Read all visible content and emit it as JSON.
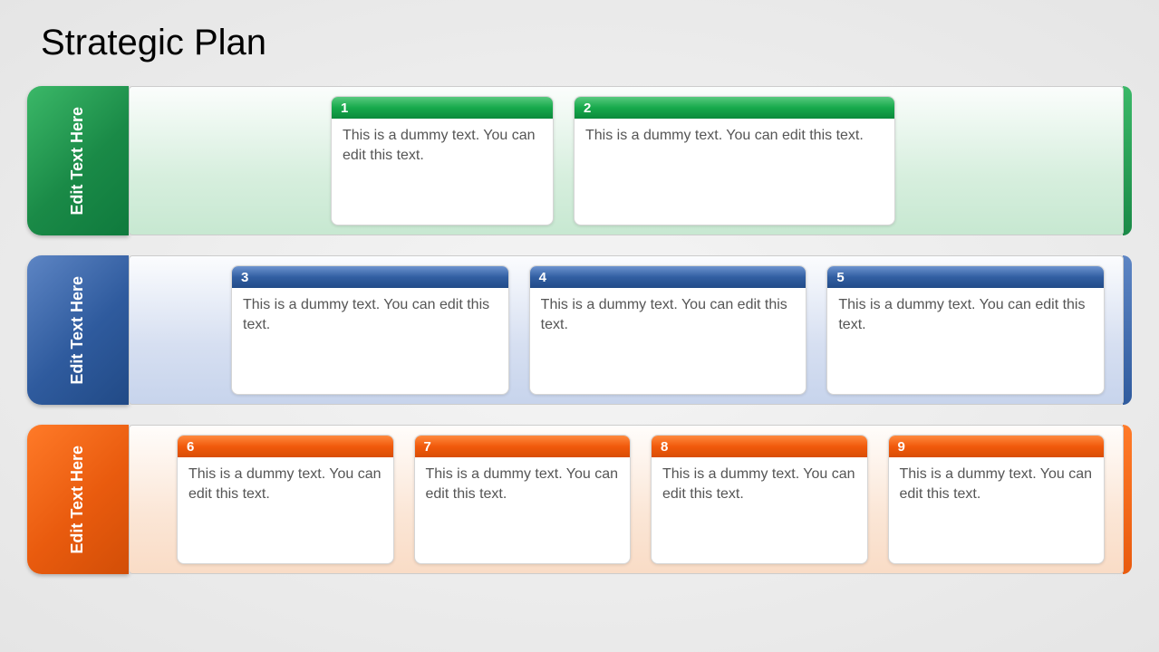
{
  "title": "Strategic Plan",
  "rows": [
    {
      "tab": "Edit Text Here",
      "cards": [
        {
          "num": "1",
          "text": "This is a dummy text. You can edit this text."
        },
        {
          "num": "2",
          "text": "This is a dummy text. You can edit this text."
        }
      ]
    },
    {
      "tab": "Edit Text Here",
      "cards": [
        {
          "num": "3",
          "text": "This is a dummy text. You can edit this text."
        },
        {
          "num": "4",
          "text": "This is a dummy text. You can edit this text."
        },
        {
          "num": "5",
          "text": "This is a dummy text. You can edit this text."
        }
      ]
    },
    {
      "tab": "Edit Text Here",
      "cards": [
        {
          "num": "6",
          "text": "This is a dummy text. You can edit this text."
        },
        {
          "num": "7",
          "text": "This is a dummy text. You can edit this text."
        },
        {
          "num": "8",
          "text": "This is a dummy text. You can edit this text."
        },
        {
          "num": "9",
          "text": "This is a dummy text. You can edit this text."
        }
      ]
    }
  ]
}
